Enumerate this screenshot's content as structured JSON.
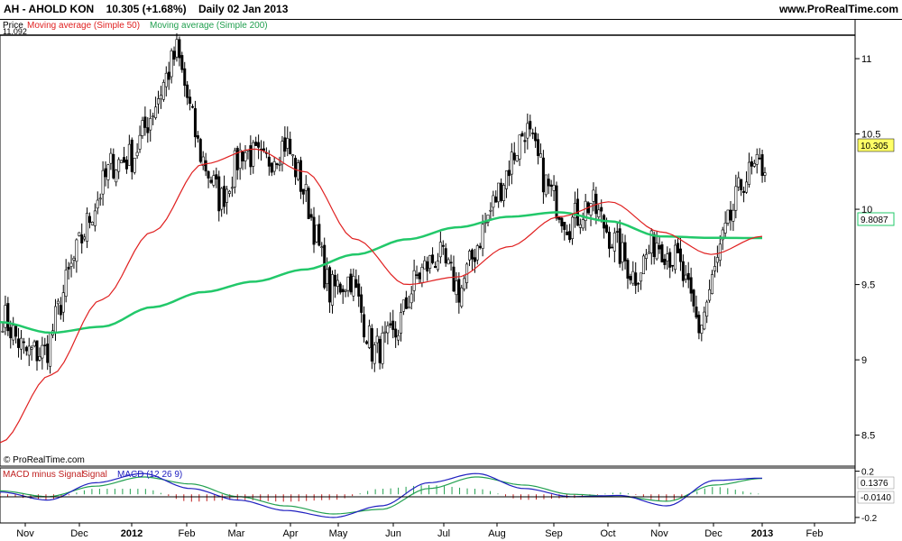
{
  "header": {
    "symbol": "AH - AHOLD KON",
    "price": "10.305 (+1.68%)",
    "period": "Daily 02 Jan 2013",
    "site": "www.ProRealTime.com"
  },
  "price_panel": {
    "legend_price": "Price",
    "legend_ma50": "Moving average (Simple 50)",
    "legend_ma200": "Moving average (Simple 200)",
    "max_label": "11.092",
    "watermark": "© ProRealTime.com",
    "last_price_label": "10.305",
    "ma200_label": "9.8087"
  },
  "macd_panel": {
    "legend_hist": "MACD minus Signal",
    "legend_signal": "Signal",
    "legend_macd": "MACD (12 26 9)",
    "value_label_1": "0.1376",
    "value_label_2": "-0.0140"
  },
  "colors": {
    "ma50": "#e02020",
    "ma200": "#22c86a",
    "macd": "#2020c0",
    "signal": "#22a050",
    "candle": "#000000",
    "hist_pos": "#22a050",
    "hist_neg": "#c02020"
  },
  "chart_data": [
    {
      "type": "candlestick",
      "title": "AH - AHOLD KON",
      "y_ticks": [
        "8.5",
        "9",
        "9.5",
        "10",
        "10.5",
        "11"
      ],
      "x_ticks": [
        "Nov",
        "Dec",
        "2012",
        "Feb",
        "Mar",
        "Apr",
        "May",
        "Jun",
        "Jul",
        "Aug",
        "Sep",
        "Oct",
        "Nov",
        "Dec",
        "2013",
        "Feb"
      ],
      "ylim": [
        8.3,
        11.15
      ],
      "close_waypoints": [
        [
          "Nov",
          9.3
        ],
        [
          "Nov",
          9.05
        ],
        [
          "Dec",
          9.05
        ],
        [
          "Dec",
          9.55
        ],
        [
          "2012",
          9.95
        ],
        [
          "2012",
          10.3
        ],
        [
          "Feb",
          10.35
        ],
        [
          "Feb",
          10.7
        ],
        [
          "Feb",
          11.05
        ],
        [
          "Mar",
          10.4
        ],
        [
          "Mar",
          10.05
        ],
        [
          "Apr",
          10.4
        ],
        [
          "Apr",
          10.3
        ],
        [
          "Apr",
          10.45
        ],
        [
          "May",
          10.05
        ],
        [
          "May",
          9.45
        ],
        [
          "May",
          9.55
        ],
        [
          "Jun",
          9.05
        ],
        [
          "Jun",
          9.15
        ],
        [
          "Jul",
          9.55
        ],
        [
          "Jul",
          9.7
        ],
        [
          "Jul",
          9.45
        ],
        [
          "Aug",
          9.85
        ],
        [
          "Aug",
          10.2
        ],
        [
          "Aug",
          10.55
        ],
        [
          "Sep",
          10.15
        ],
        [
          "Sep",
          9.9
        ],
        [
          "Sep",
          10.05
        ],
        [
          "Oct",
          9.8
        ],
        [
          "Oct",
          9.55
        ],
        [
          "Oct",
          9.8
        ],
        [
          "Nov",
          9.65
        ],
        [
          "Nov",
          9.2
        ],
        [
          "Dec",
          9.75
        ],
        [
          "Dec",
          10.2
        ],
        [
          "2013",
          10.3
        ]
      ],
      "series": [
        {
          "name": "Moving average (Simple 50)",
          "waypoints": [
            8.45,
            8.9,
            9.4,
            9.85,
            10.3,
            10.4,
            10.25,
            9.8,
            9.5,
            9.55,
            9.75,
            9.95,
            10.05,
            9.85,
            9.7,
            9.82
          ]
        },
        {
          "name": "Moving average (Simple 200)",
          "waypoints": [
            9.25,
            9.18,
            9.22,
            9.35,
            9.45,
            9.52,
            9.6,
            9.7,
            9.8,
            9.88,
            9.95,
            9.98,
            9.92,
            9.82,
            9.81,
            9.8087
          ]
        }
      ]
    },
    {
      "type": "line",
      "title": "MACD (12 26 9)",
      "y_ticks": [
        "0.2",
        "-0.2"
      ],
      "ylim": [
        -0.24,
        0.22
      ],
      "series": [
        {
          "name": "MACD",
          "waypoints": [
            0.02,
            -0.05,
            0.1,
            0.18,
            0.05,
            -0.05,
            -0.14,
            -0.2,
            -0.1,
            0.1,
            0.18,
            0.05,
            -0.02,
            -0.01,
            -0.1,
            0.12,
            0.14
          ]
        },
        {
          "name": "Signal",
          "waypoints": [
            0.03,
            -0.02,
            0.07,
            0.15,
            0.09,
            -0.02,
            -0.1,
            -0.17,
            -0.13,
            0.05,
            0.15,
            0.08,
            0.0,
            -0.02,
            -0.06,
            0.08,
            0.137
          ]
        }
      ]
    }
  ]
}
